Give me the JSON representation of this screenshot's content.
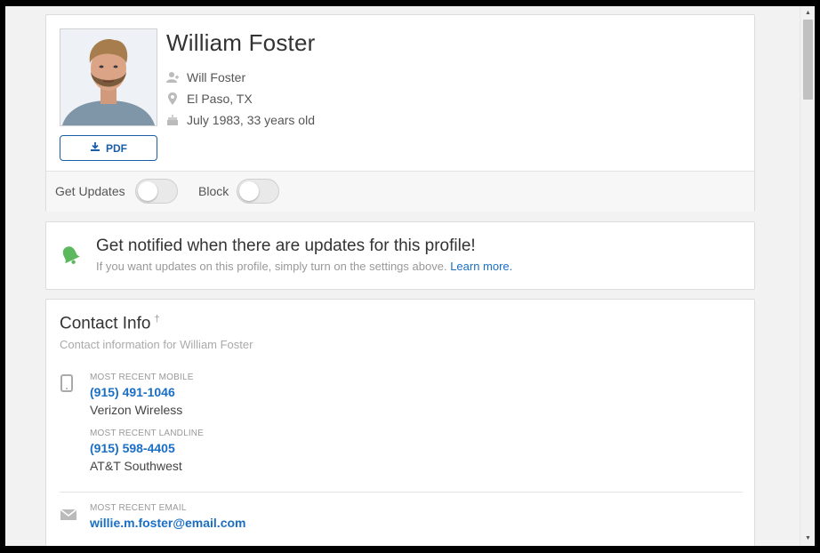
{
  "profile": {
    "name": "William Foster",
    "alias": "Will Foster",
    "location": "El Paso, TX",
    "birth": "July 1983, 33 years old",
    "pdf_label": "PDF"
  },
  "toggles": {
    "updates_label": "Get Updates",
    "block_label": "Block"
  },
  "notify": {
    "title": "Get notified when there are updates for this profile!",
    "subtitle": "If you want updates on this profile, simply turn on the settings above.",
    "link": "Learn more."
  },
  "contact": {
    "title": "Contact Info",
    "title_mark": "†",
    "subtitle": "Contact information for William Foster",
    "mobile_label": "MOST RECENT MOBILE",
    "mobile_number": "(915) 491-1046",
    "mobile_carrier": "Verizon Wireless",
    "landline_label": "MOST RECENT LANDLINE",
    "landline_number": "(915) 598-4405",
    "landline_carrier": "AT&T Southwest",
    "email_label": "MOST RECENT EMAIL",
    "email": "willie.m.foster@email.com"
  },
  "colors": {
    "accent": "#1a6fc4",
    "bell": "#5cb85c"
  },
  "icons": {
    "pdf": "download-icon",
    "alias": "user-plus-icon",
    "location": "map-pin-icon",
    "birth": "cake-icon",
    "notify": "bell-icon",
    "phone": "phone-icon",
    "email": "envelope-icon"
  }
}
